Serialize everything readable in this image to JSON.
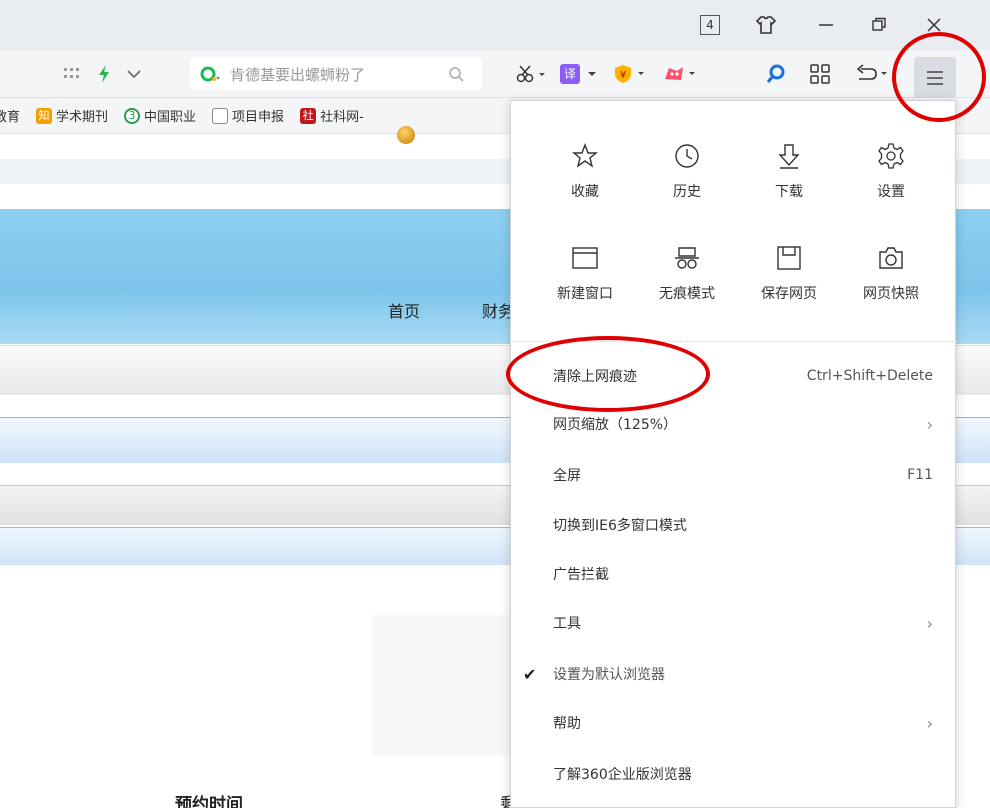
{
  "window": {
    "tab_count": "4",
    "skin_icon": "shirt-icon",
    "minimize_icon": "minimize-icon",
    "restore_icon": "restore-icon",
    "close_icon": "close-icon"
  },
  "toolbar": {
    "search_placeholder": "肯德基要出螺蛳粉了",
    "translate_label": "译",
    "menu_icon": "hamburger-menu-icon"
  },
  "bookmarks": [
    {
      "label": "教育"
    },
    {
      "label": "学术期刊"
    },
    {
      "label": "中国职业"
    },
    {
      "label": "项目申报"
    },
    {
      "label": "社科网-"
    }
  ],
  "page": {
    "nav_home": "首页",
    "nav_finance": "财务",
    "bottom_left": "预约时间",
    "bottom_right": "剩余"
  },
  "menu": {
    "grid": [
      {
        "label": "收藏",
        "icon": "star-icon"
      },
      {
        "label": "历史",
        "icon": "clock-icon"
      },
      {
        "label": "下载",
        "icon": "download-icon"
      },
      {
        "label": "设置",
        "icon": "gear-icon"
      },
      {
        "label": "新建窗口",
        "icon": "new-window-icon"
      },
      {
        "label": "无痕模式",
        "icon": "incognito-icon"
      },
      {
        "label": "保存网页",
        "icon": "save-page-icon"
      },
      {
        "label": "网页快照",
        "icon": "camera-icon"
      }
    ],
    "items": [
      {
        "label": "清除上网痕迹",
        "shortcut": "Ctrl+Shift+Delete"
      },
      {
        "label": "网页缩放（125%）",
        "submenu": true
      },
      {
        "label": "全屏",
        "shortcut": "F11"
      },
      {
        "label": "切换到IE6多窗口模式"
      },
      {
        "label": "广告拦截"
      },
      {
        "label": "工具",
        "submenu": true
      },
      {
        "label": "设置为默认浏览器",
        "checked": true
      },
      {
        "label": "帮助",
        "submenu": true
      },
      {
        "label": "了解360企业版浏览器"
      }
    ]
  },
  "colors": {
    "annotation": "#e00000",
    "hero": "#7ec5ec"
  }
}
